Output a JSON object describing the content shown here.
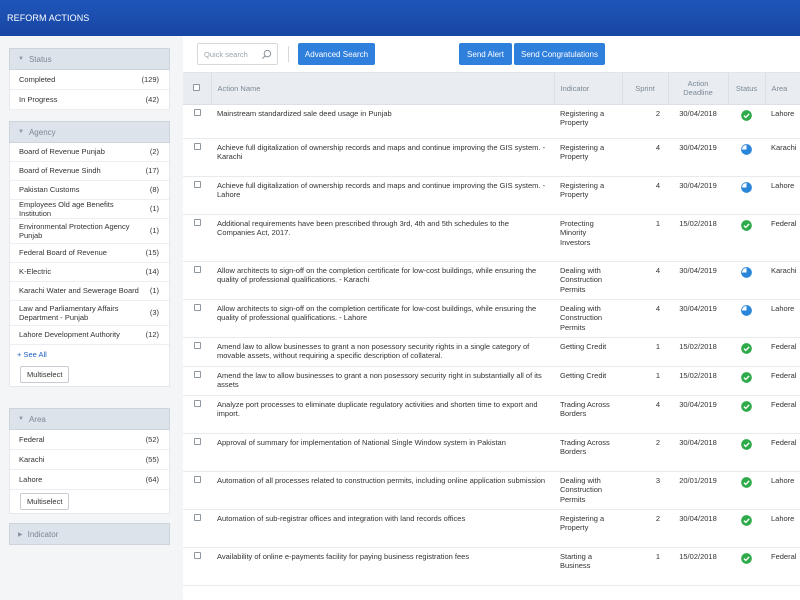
{
  "app": {
    "title": "REFORM ACTIONS"
  },
  "colors": {
    "header": "#1a4eae",
    "accent": "#2f7fdc",
    "done": "#2faa4a",
    "in_progress": "#2a86d8"
  },
  "sidebar": {
    "status": {
      "title": "Status",
      "items": [
        {
          "label": "Completed",
          "count": "(129)"
        },
        {
          "label": "In Progress",
          "count": "(42)"
        }
      ]
    },
    "agency": {
      "title": "Agency",
      "items": [
        {
          "label": "Board of Revenue Punjab",
          "count": "(2)"
        },
        {
          "label": "Board of Revenue Sindh",
          "count": "(17)"
        },
        {
          "label": "Pakistan Customs",
          "count": "(8)"
        },
        {
          "label": "Employees Old age Benefits Institution",
          "count": "(1)"
        },
        {
          "label": "Environmental Protection Agency Punjab",
          "count": "(1)"
        },
        {
          "label": "Federal Board of Revenue",
          "count": "(15)"
        },
        {
          "label": "K-Electric",
          "count": "(14)"
        },
        {
          "label": "Karachi Water and Sewerage Board",
          "count": "(1)"
        },
        {
          "label": "Law and Parliamentary Affairs Department - Punjab",
          "count": "(3)"
        },
        {
          "label": "Lahore Development Authority",
          "count": "(12)"
        }
      ],
      "see_all": "+ See All",
      "multiselect": "Multiselect"
    },
    "area": {
      "title": "Area",
      "items": [
        {
          "label": "Federal",
          "count": "(52)"
        },
        {
          "label": "Karachi",
          "count": "(55)"
        },
        {
          "label": "Lahore",
          "count": "(64)"
        }
      ],
      "multiselect": "Multiselect"
    },
    "indicator": {
      "title": "Indicator"
    }
  },
  "toolbar": {
    "search_placeholder": "Quick search",
    "advanced_search": "Advanced Search",
    "send_alert": "Send Alert",
    "send_congrats": "Send Congratulations"
  },
  "table": {
    "columns": {
      "action_name": "Action Name",
      "indicator": "Indicator",
      "sprint": "Sprint",
      "deadline_1": "Action",
      "deadline_2": "Deadline",
      "status": "Status",
      "area": "Area"
    },
    "rows": [
      {
        "action": "Mainstream standardized sale deed usage in Punjab",
        "indicator": "Registering a Property",
        "sprint": "2",
        "deadline": "30/04/2018",
        "status": "done",
        "area": "Lahore"
      },
      {
        "action": "Achieve full digitalization of ownership records and maps and continue improving the GIS system. - Karachi",
        "indicator": "Registering a Property",
        "sprint": "4",
        "deadline": "30/04/2019",
        "status": "in_progress",
        "area": "Karachi"
      },
      {
        "action": "Achieve full digitalization of ownership records and maps and continue improving the GIS system. - Lahore",
        "indicator": "Registering a Property",
        "sprint": "4",
        "deadline": "30/04/2019",
        "status": "in_progress",
        "area": "Lahore"
      },
      {
        "action": "Additional requirements have been prescribed through 3rd, 4th and 5th schedules to the Companies Act, 2017.",
        "indicator": "Protecting Minority Investors",
        "sprint": "1",
        "deadline": "15/02/2018",
        "status": "done",
        "area": "Federal"
      },
      {
        "action": "Allow architects to sign-off on the completion certificate for low-cost buildings, while ensuring the quality of professional qualifications. - Karachi",
        "indicator": "Dealing with Construction Permits",
        "sprint": "4",
        "deadline": "30/04/2019",
        "status": "in_progress",
        "area": "Karachi"
      },
      {
        "action": "Allow architects to sign-off on the completion certificate for low-cost buildings, while ensuring the quality of professional qualifications. - Lahore",
        "indicator": "Dealing with Construction Permits",
        "sprint": "4",
        "deadline": "30/04/2019",
        "status": "in_progress",
        "area": "Lahore"
      },
      {
        "action": "Amend law to allow businesses to grant a non posessory security rights in a single category of movable assets, without requiring a specific description of collateral.",
        "indicator": "Getting Credit",
        "sprint": "1",
        "deadline": "15/02/2018",
        "status": "done",
        "area": "Federal"
      },
      {
        "action": "Amend the law to allow businesses to grant a non posessory security right in substantially all of its assets",
        "indicator": "Getting Credit",
        "sprint": "1",
        "deadline": "15/02/2018",
        "status": "done",
        "area": "Federal"
      },
      {
        "action": "Analyze port processes to eliminate duplicate regulatory activities and shorten time to export and import.",
        "indicator": "Trading Across Borders",
        "sprint": "4",
        "deadline": "30/04/2019",
        "status": "done",
        "area": "Federal"
      },
      {
        "action": "Approval of summary for implementation of National Single Window system in Pakistan",
        "indicator": "Trading Across Borders",
        "sprint": "2",
        "deadline": "30/04/2018",
        "status": "done",
        "area": "Federal"
      },
      {
        "action": "Automation of all processes related to construction permits, including online application submission",
        "indicator": "Dealing with Construction Permits",
        "sprint": "3",
        "deadline": "20/01/2019",
        "status": "done",
        "area": "Lahore"
      },
      {
        "action": "Automation of sub-registrar offices and integration with land records offices",
        "indicator": "Registering a Property",
        "sprint": "2",
        "deadline": "30/04/2018",
        "status": "done",
        "area": "Lahore"
      },
      {
        "action": "Availability of online e-payments facility for paying business registration fees",
        "indicator": "Starting a Business",
        "sprint": "1",
        "deadline": "15/02/2018",
        "status": "done",
        "area": "Federal"
      }
    ]
  }
}
